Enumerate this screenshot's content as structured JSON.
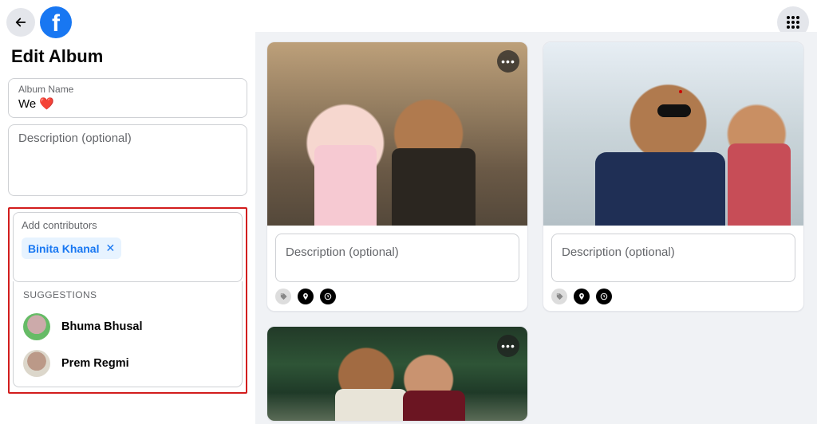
{
  "header": {
    "page_title": "Edit Album"
  },
  "album_name": {
    "label": "Album Name",
    "value": "We ❤️"
  },
  "description": {
    "placeholder": "Description (optional)"
  },
  "contributors": {
    "label": "Add contributors",
    "chips": [
      {
        "name": "Binita Khanal"
      }
    ]
  },
  "suggestions": {
    "header": "SUGGESTIONS",
    "items": [
      {
        "name": "Bhuma Bhusal"
      },
      {
        "name": "Prem Regmi"
      }
    ]
  },
  "photos": [
    {
      "description_placeholder": "Description (optional)"
    },
    {
      "description_placeholder": "Description (optional)"
    }
  ]
}
